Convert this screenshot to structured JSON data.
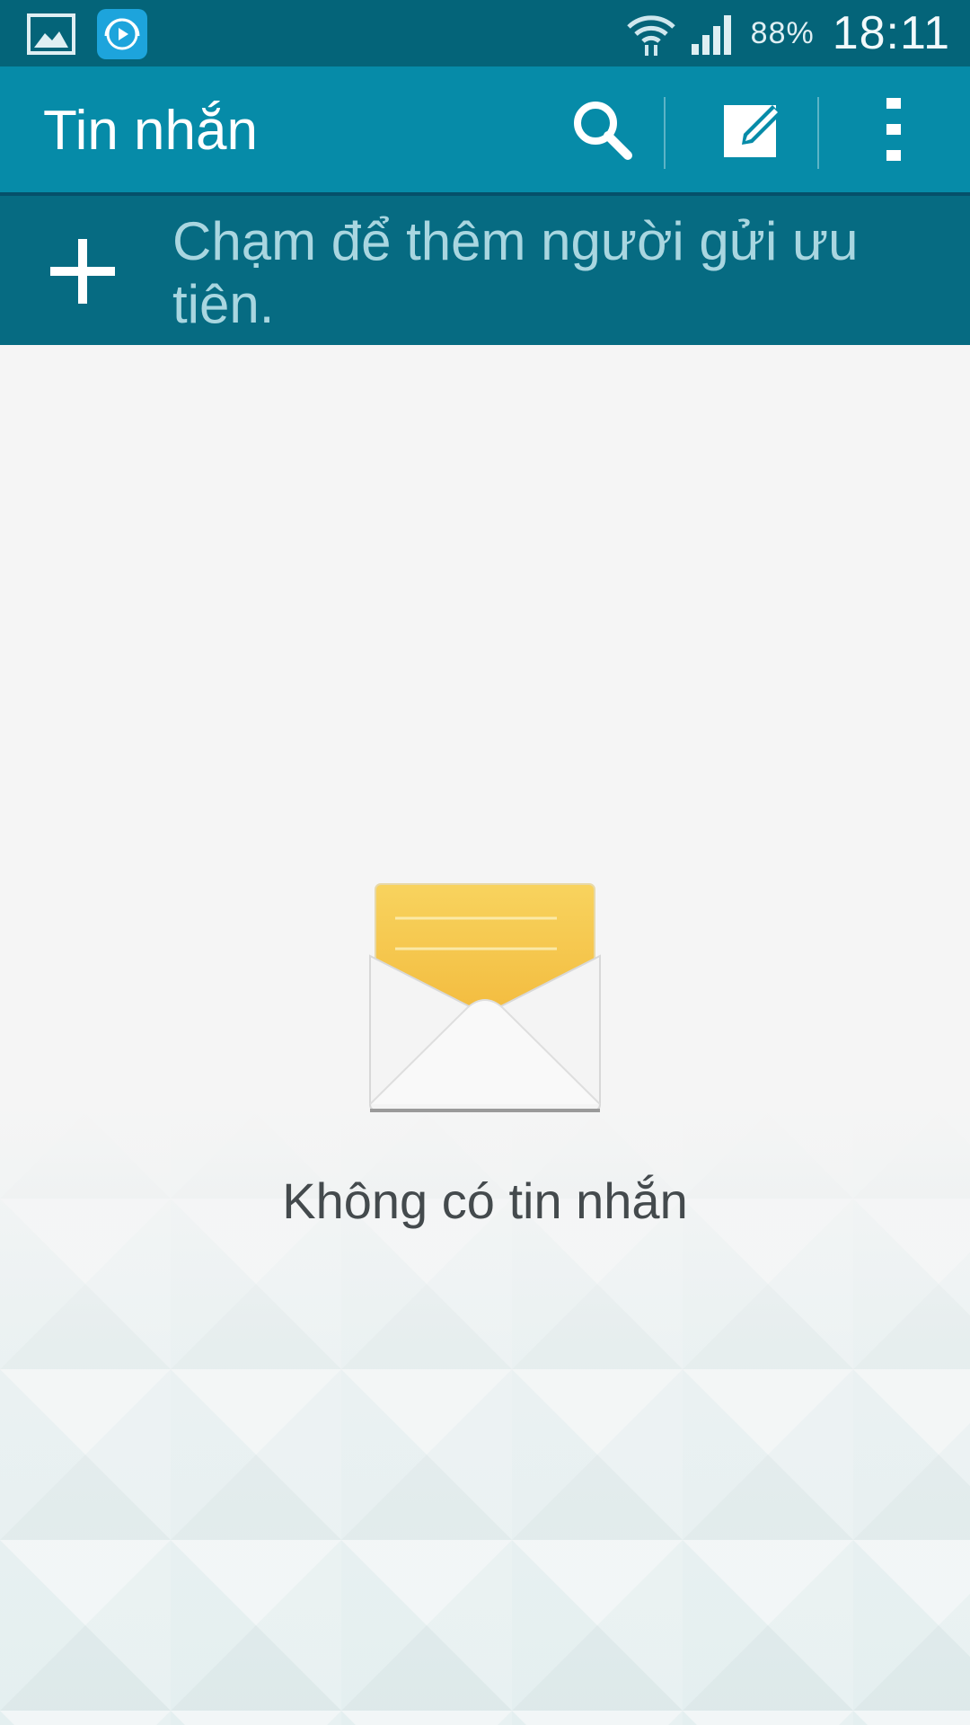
{
  "status_bar": {
    "left_icons": [
      "gallery-icon",
      "media-app-icon"
    ],
    "right_icons": [
      "wifi-icon",
      "signal-icon"
    ],
    "battery": "88%",
    "time": "18:11"
  },
  "action_bar": {
    "title": "Tin nhắn",
    "actions": [
      "search-icon",
      "compose-icon",
      "overflow-menu-icon"
    ],
    "background": "#068ba8"
  },
  "priority_banner": {
    "text": "Chạm để thêm người gửi ưu tiên.",
    "icon": "plus-icon",
    "background": "#066b82"
  },
  "empty_state": {
    "icon": "envelope-icon",
    "text": "Không có tin nhắn"
  },
  "colors": {
    "status_bar": "#046479",
    "accent": "#068ba8",
    "envelope_letter": "#f6c94e",
    "background": "#f5f5f5"
  }
}
